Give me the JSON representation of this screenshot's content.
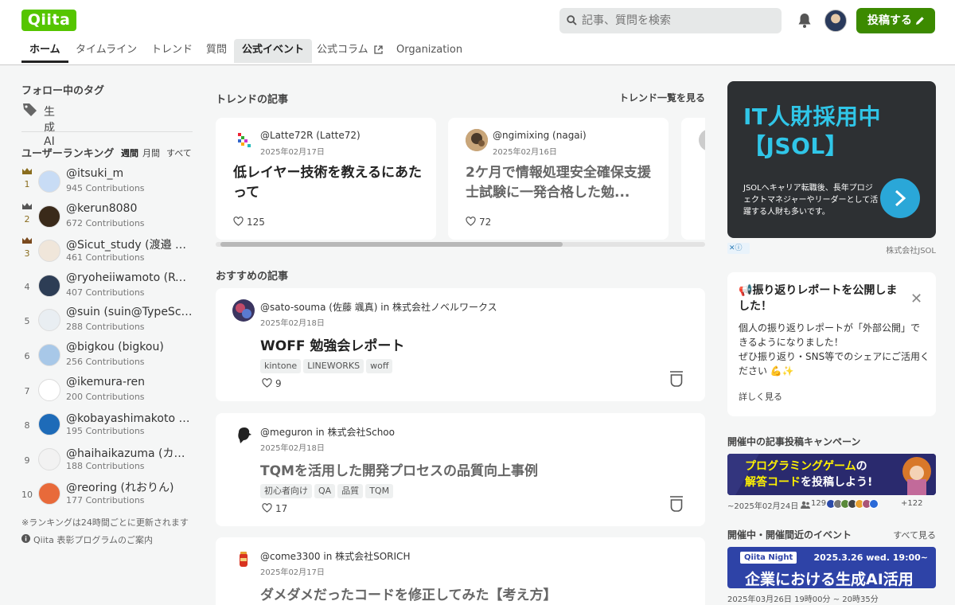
{
  "header": {
    "logo": "Qiita",
    "search_placeholder": "記事、質問を検索",
    "post_button": "投稿する"
  },
  "nav": {
    "tabs": [
      {
        "label": "ホーム"
      },
      {
        "label": "タイムライン"
      },
      {
        "label": "トレンド"
      },
      {
        "label": "質問"
      },
      {
        "label": "公式イベント"
      },
      {
        "label": "公式コラム"
      },
      {
        "label": "Organization"
      }
    ]
  },
  "sidebar": {
    "follow_tags_title": "フォロー中のタグ",
    "follow_tag": "生成AI",
    "ranking_title": "ユーザーランキング",
    "periods": [
      "週間",
      "月間",
      "すべて"
    ],
    "ranking": [
      {
        "rank": "1",
        "name": "@itsuki_m",
        "contributions": "945 Contributions"
      },
      {
        "rank": "2",
        "name": "@kerun8080",
        "contributions": "672 Contributions"
      },
      {
        "rank": "3",
        "name": "@Sicut_study (渡邉 臣 | ...",
        "contributions": "461 Contributions"
      },
      {
        "rank": "4",
        "name": "@ryoheiiwamoto (Ryoh...",
        "contributions": "407 Contributions"
      },
      {
        "rank": "5",
        "name": "@suin (suin@TypeScript...",
        "contributions": "288 Contributions"
      },
      {
        "rank": "6",
        "name": "@bigkou (bigkou)",
        "contributions": "256 Contributions"
      },
      {
        "rank": "7",
        "name": "@ikemura-ren",
        "contributions": "200 Contributions"
      },
      {
        "rank": "8",
        "name": "@kobayashimakoto (誠 ...",
        "contributions": "195 Contributions"
      },
      {
        "rank": "9",
        "name": "@haihaikazuma (カズマ...",
        "contributions": "188 Contributions"
      },
      {
        "rank": "10",
        "name": "@reoring (れおりん)",
        "contributions": "177 Contributions"
      }
    ],
    "ranking_note": "※ランキングは24時間ごとに更新されます",
    "program_link": "Qiita 表彰プログラムのご案内"
  },
  "trend": {
    "title": "トレンドの記事",
    "see_all": "トレンド一覧を見る",
    "cards": [
      {
        "user": "@Latte72R (Latte72)",
        "date": "2025年02月17日",
        "title": "低レイヤー技術を教えるにあたって",
        "likes": "125"
      },
      {
        "user": "@ngimixing (nagai)",
        "date": "2025年02月16日",
        "title": "2ケ月で情報処理安全確保支援士試験に一発合格した勉...",
        "likes": "72"
      }
    ]
  },
  "recommended": {
    "title": "おすすめの記事",
    "articles": [
      {
        "user": "@sato-souma (佐藤 颯真) in 株式会社ノベルワークス",
        "date": "2025年02月18日",
        "title": "WOFF 勉強会レポート",
        "tags": [
          "kintone",
          "LINEWORKS",
          "woff"
        ],
        "likes": "9"
      },
      {
        "user": "@meguron in 株式会社Schoo",
        "date": "2025年02月18日",
        "title": "TQMを活用した開発プロセスの品質向上事例",
        "tags": [
          "初心者向け",
          "QA",
          "品質",
          "TQM"
        ],
        "likes": "17"
      },
      {
        "user": "@come3300 in 株式会社SORICH",
        "date": "2025年02月17日",
        "title": "ダメダメだったコードを修正してみた【考え方】"
      }
    ]
  },
  "ad": {
    "headline": "IT人財採用中【JSOL】",
    "body": "JSOLへキャリア転職後、長年プロジェクトマネジャーやリーダーとして活躍する人財も多いです。",
    "company": "株式会社JSOL"
  },
  "notice": {
    "title": "📢振り返りレポートを公開しました！",
    "body": "個人の振り返りレポートが「外部公開」できるようになりました！\nぜひ振り返り・SNS等でのシェアにご活用ください 💪✨",
    "more": "詳しく見る"
  },
  "campaign": {
    "title": "開催中の記事投稿キャンペーン",
    "banner_line1_a": "プログラミングゲーム",
    "banner_line1_b": "の",
    "banner_line2_a": "解答コード",
    "banner_line2_b": "を投稿しよう!",
    "until": "~2025年02月24日",
    "count": "129",
    "extra": "+122"
  },
  "events": {
    "title": "開催中・開催間近のイベント",
    "see_all": "すべて見る",
    "banner_tag": "Qiita Night",
    "banner_when": "2025.3.26 wed. 19:00~",
    "banner_main": "企業における生成AI活用",
    "time": "2025年03月26日 19時00分 ~ 20時35分"
  },
  "colors": {
    "brand": "#55c500",
    "post_button": "#3c8a00",
    "ad_accent": "#30c6e8"
  }
}
